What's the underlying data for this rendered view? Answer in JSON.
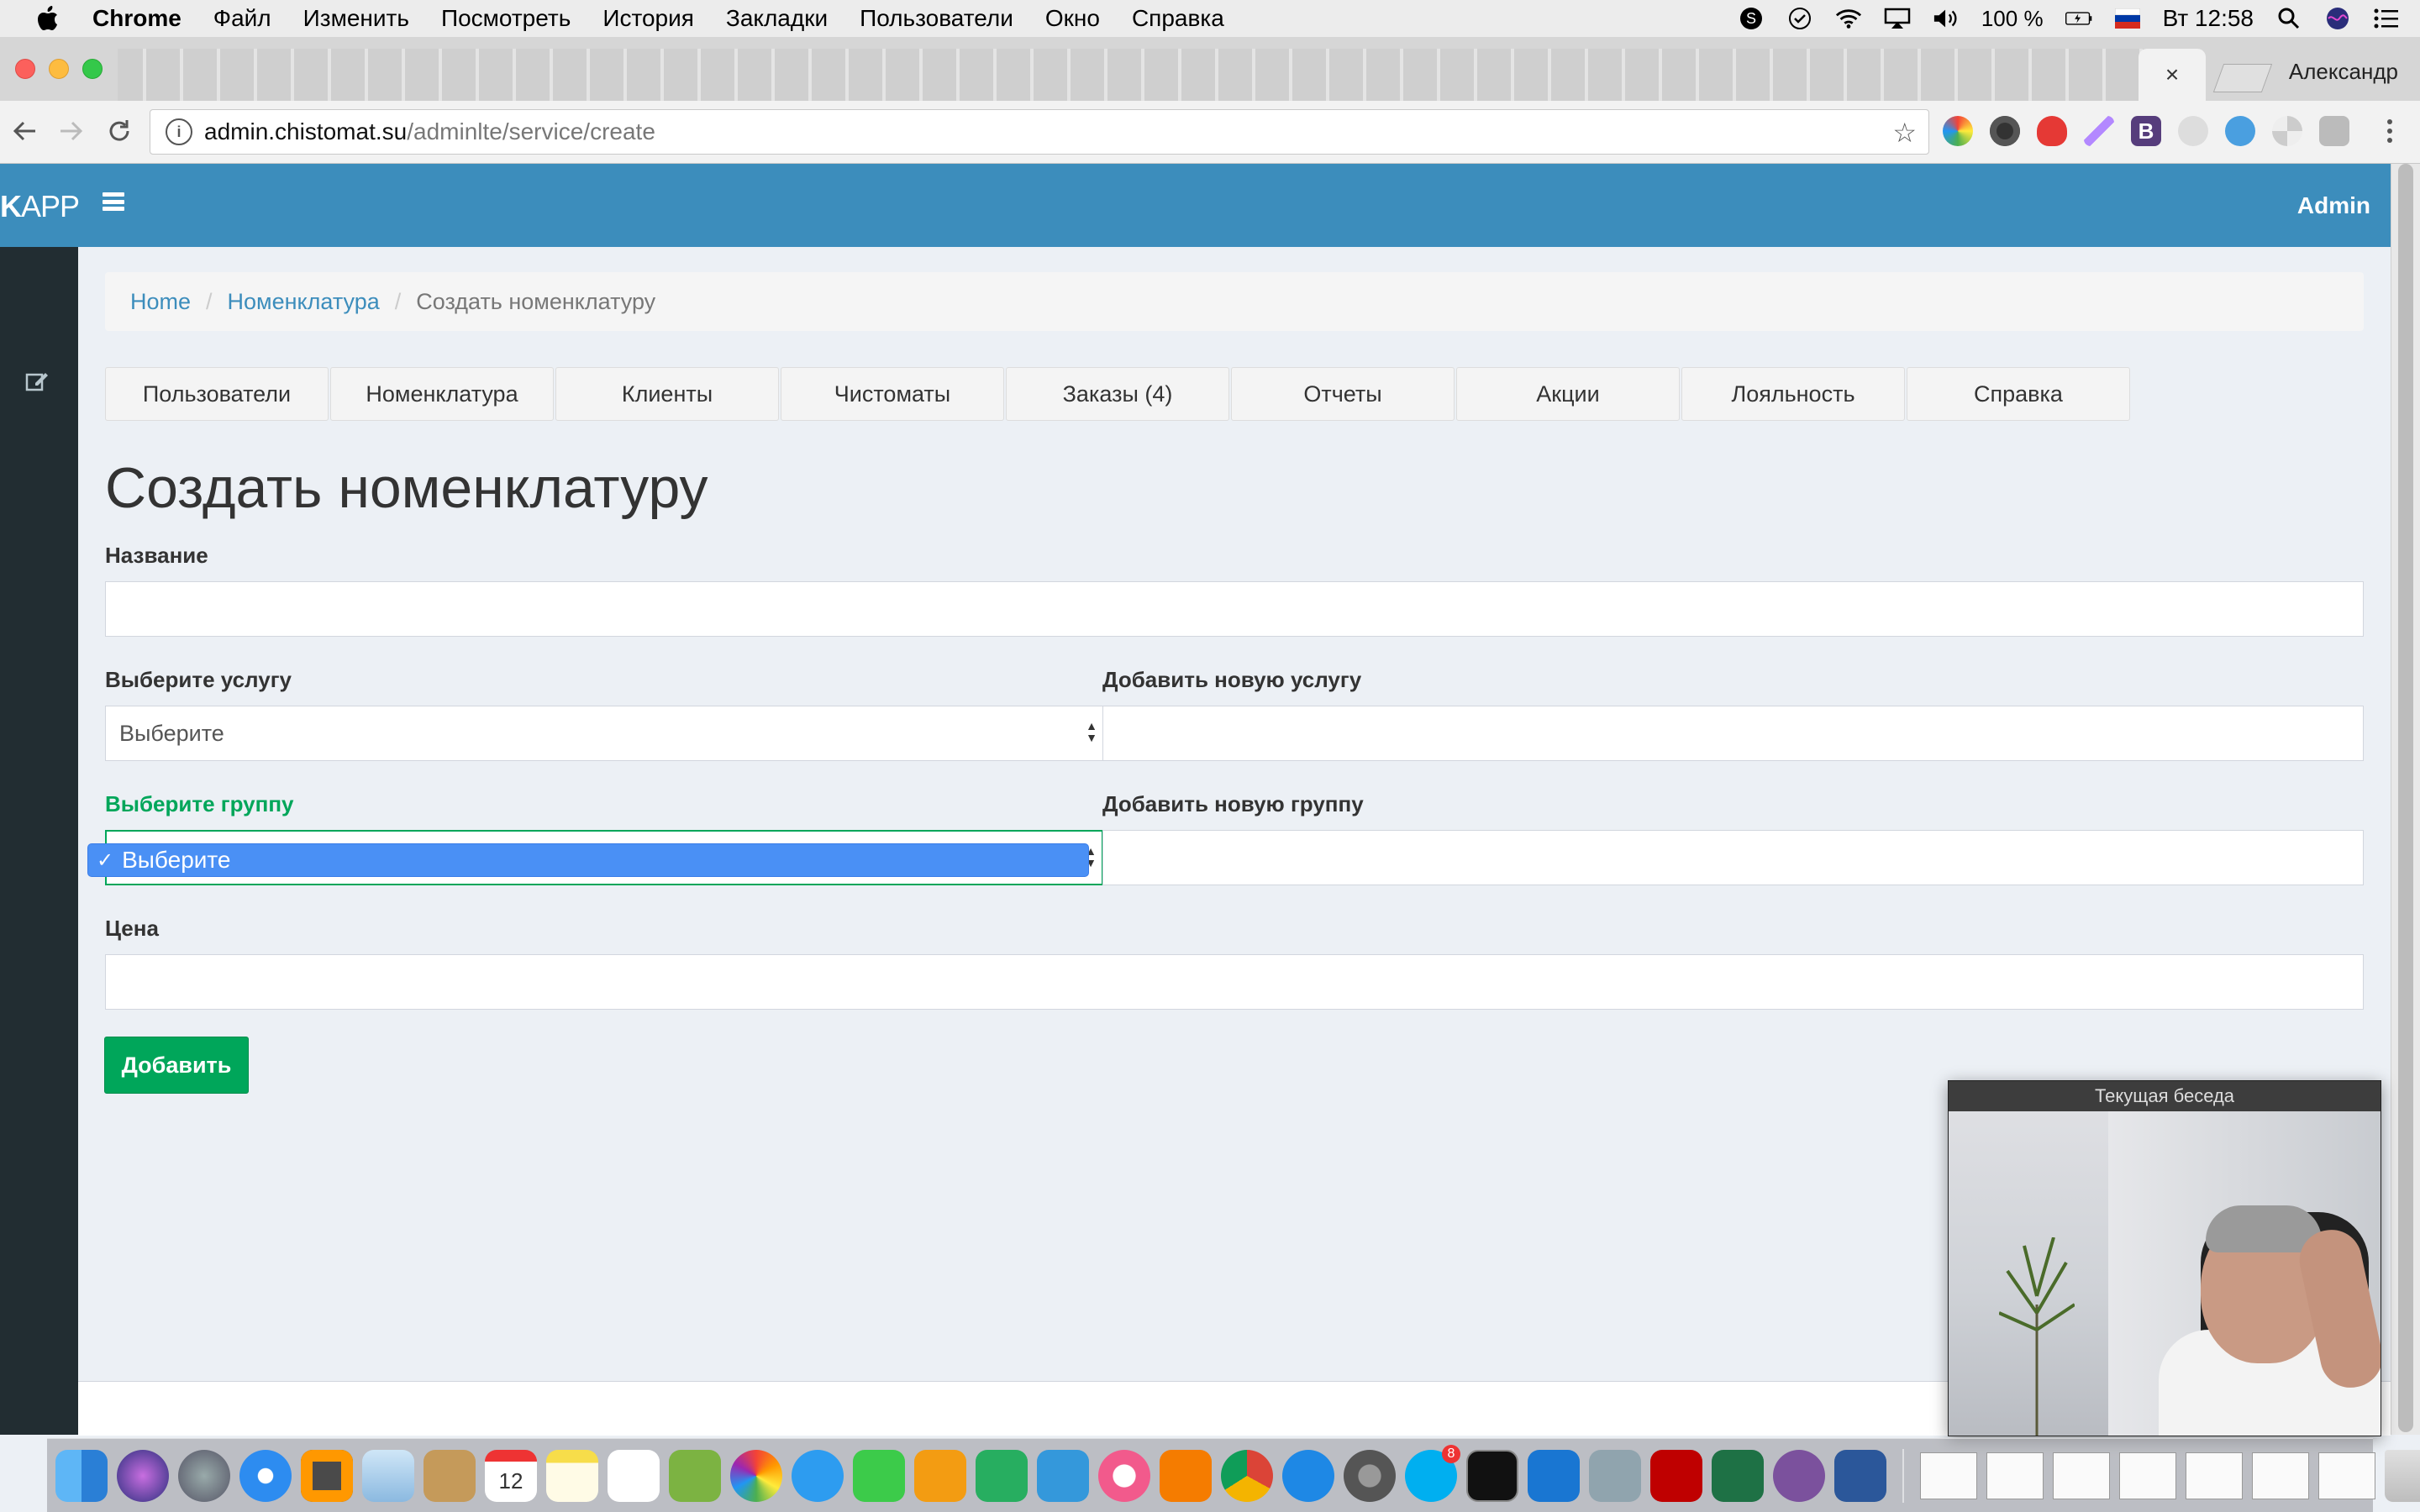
{
  "menubar": {
    "items": [
      "Chrome",
      "Файл",
      "Изменить",
      "Посмотреть",
      "История",
      "Закладки",
      "Пользователи",
      "Окно",
      "Справка"
    ],
    "battery": "100 %",
    "clock": "Вт 12:58"
  },
  "browser": {
    "active_tab_close": "×",
    "profile": "Александр",
    "url_host": "admin.chistomat.su",
    "url_path": "/adminlte/service/create",
    "extension_icons": [
      "color-wheel-icon",
      "camera-icon",
      "shield-icon",
      "pen-icon",
      "bootstrap-icon",
      "moon-icon",
      "check-circle-icon",
      "pinwheel-icon",
      "cast-icon"
    ]
  },
  "app": {
    "logo_bold": "K",
    "logo_rest": "APP",
    "user": "Admin"
  },
  "breadcrumb": {
    "home": "Home",
    "section": "Номенклатура",
    "current": "Создать номенклатуру",
    "separator": "/"
  },
  "nav_tabs": [
    "Пользователи",
    "Номенклатура",
    "Клиенты",
    "Чистоматы",
    "Заказы (4)",
    "Отчеты",
    "Акции",
    "Лояльность",
    "Справка"
  ],
  "form": {
    "title": "Создать номенклатуру",
    "name_label": "Название",
    "name_value": "",
    "service_label": "Выберите услугу",
    "service_value": "Выберите",
    "new_service_label": "Добавить новую услугу",
    "new_service_value": "",
    "group_label": "Выберите группу",
    "group_selected_option": "Выберите",
    "new_group_label": "Добавить новую группу",
    "new_group_value": "",
    "price_label": "Цена",
    "price_value": "",
    "submit_label": "Добавить"
  },
  "call_window": {
    "title": "Текущая беседа"
  },
  "colors": {
    "header": "#3c8dbc",
    "sidebar": "#222d32",
    "success": "#00a65a",
    "dropdown_highlight": "#4a90f5"
  },
  "dock": {
    "apps": [
      "finder-icon",
      "siri-icon",
      "launchpad-icon",
      "safari-icon",
      "sublime-icon",
      "mail-icon",
      "contacts-icon",
      "calendar-icon",
      "notes-icon",
      "reminders-icon",
      "preview-icon",
      "photos-icon",
      "messages-icon",
      "facetime-icon",
      "pages-icon",
      "numbers-icon",
      "keynote-icon",
      "itunes-icon",
      "ibooks-icon",
      "chrome-icon",
      "appstore-icon",
      "system-preferences-icon",
      "skype-icon",
      "terminal-icon",
      "xcode-icon",
      "image-capture-icon",
      "filezilla-icon",
      "excel-icon",
      "viber-icon",
      "word-icon"
    ],
    "calendar_day": "12",
    "skype_badge": "8"
  }
}
